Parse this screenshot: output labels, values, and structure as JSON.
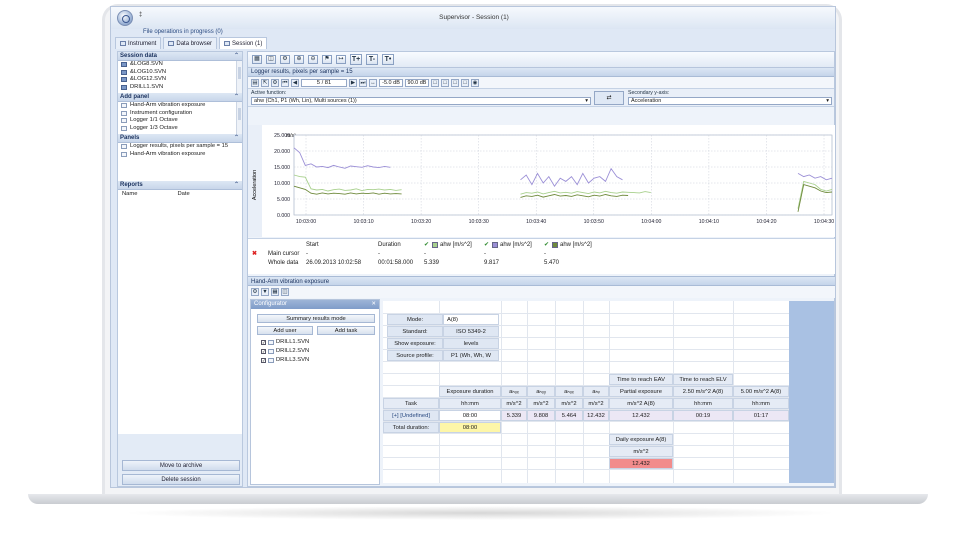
{
  "window": {
    "title": "Supervisor - Session (1)",
    "file_ops": "File operations in progress (0)",
    "qa": "‡"
  },
  "tabs": [
    "Instrument",
    "Data browser",
    "Session (1)"
  ],
  "left": {
    "session_data": {
      "title": "Session data",
      "items": [
        "&LOG8.SVN",
        "&LOG10.SVN",
        "&LOG12.SVN",
        "DRILL1.SVN"
      ]
    },
    "add_panel": {
      "title": "Add panel",
      "items": [
        "Hand-Arm vibration exposure",
        "Instrument configuration",
        "Logger 1/1 Octave",
        "Logger 1/3 Octave"
      ]
    },
    "panels": {
      "title": "Panels",
      "items": [
        "Logger results, pixels per sample = 15",
        "Hand-Arm vibration exposure"
      ]
    },
    "reports": {
      "title": "Reports",
      "col_name": "Name",
      "col_date": "Date"
    },
    "btn_archive": "Move to archive",
    "btn_delete": "Delete session"
  },
  "logger": {
    "title": "Logger results, pixels per sample = 15",
    "nav_value": "5 / 81",
    "db_low": "-5.0 dB",
    "db_high": "90.0 dB",
    "active_function_label": "Active function:",
    "active_function_value": "ahw (Ch1, P1 (Wh, Lin), Multi sources (1))",
    "secondary_label": "Secondary y-axis:",
    "secondary_value": "Acceleration",
    "tb_labels": [
      "T+",
      "T-",
      "T•"
    ]
  },
  "chart_data": {
    "type": "line",
    "ylabel": "Acceleration",
    "yunit": "m/s²",
    "ylim": [
      0,
      25
    ],
    "yticks": [
      "25.000",
      "20.000",
      "15.000",
      "10.000",
      "5.000",
      "0.000"
    ],
    "xticks": [
      "10:03:00",
      "10:03:10",
      "10:03:20",
      "10:03:30",
      "10:03:40",
      "10:03:50",
      "10:04:00",
      "10:04:10",
      "10:04:20",
      "10:04:30"
    ],
    "x": [
      0,
      1,
      2,
      3,
      4,
      5,
      6,
      7,
      8,
      9,
      10,
      11,
      12,
      13,
      14,
      15,
      16,
      17,
      18,
      19,
      20,
      21,
      22,
      23,
      24,
      25,
      26,
      27,
      28,
      29,
      30,
      31,
      32,
      33,
      34,
      35,
      36,
      37,
      38,
      39,
      40,
      41,
      42,
      43,
      44,
      45,
      46,
      47,
      48,
      49,
      50,
      51,
      52,
      53,
      54,
      55,
      56,
      57,
      58,
      59,
      60,
      61,
      62,
      63,
      64,
      65,
      66,
      67,
      68,
      69,
      70,
      71,
      72,
      73,
      74,
      75,
      76,
      77,
      78,
      79,
      80,
      81,
      82,
      83,
      84,
      85,
      86,
      87,
      88,
      89,
      90,
      91,
      92,
      93,
      94,
      95
    ],
    "series": [
      {
        "name": "ahw [m/s^2]",
        "color": "#a8d08d",
        "values": [
          12.5,
          12.0,
          11.8,
          8.2,
          7.8,
          8.0,
          7.5,
          7.9,
          8.1,
          7.7,
          7.8,
          8.2,
          7.6,
          8.0,
          7.9,
          8.1,
          7.8,
          8.0,
          7.7,
          7.9,
          null,
          null,
          null,
          null,
          null,
          null,
          null,
          null,
          null,
          null,
          null,
          null,
          null,
          null,
          null,
          null,
          null,
          null,
          null,
          null,
          6.5,
          7.0,
          6.8,
          7.2,
          6.6,
          7.0,
          7.4,
          6.9,
          7.1,
          6.8,
          7.3,
          7.0,
          6.7,
          7.2,
          6.9,
          7.4,
          7.0,
          6.8,
          7.2,
          7.1,
          7.0,
          6.9,
          7.3,
          7.0,
          null,
          null,
          null,
          null,
          null,
          null,
          null,
          null,
          null,
          null,
          null,
          null,
          null,
          null,
          null,
          null,
          null,
          null,
          null,
          null,
          null,
          null,
          null,
          null,
          null,
          2.0,
          10.5,
          10.0,
          9.5,
          8.0,
          7.5,
          8.0
        ]
      },
      {
        "name": "ahw [m/s^2]",
        "color": "#9b8fd6",
        "values": [
          21.0,
          19.5,
          15.5,
          16.0,
          15.0,
          15.2,
          14.8,
          15.5,
          15.0,
          14.6,
          15.3,
          15.1,
          14.9,
          15.4,
          15.0,
          14.8,
          15.2,
          14.9,
          null,
          null,
          null,
          null,
          null,
          null,
          null,
          null,
          null,
          null,
          null,
          null,
          null,
          null,
          null,
          null,
          null,
          null,
          null,
          null,
          null,
          null,
          11.0,
          12.5,
          9.5,
          13.0,
          10.0,
          12.0,
          9.0,
          11.5,
          10.5,
          12.0,
          9.5,
          13.0,
          10.0,
          11.5,
          12.0,
          10.5,
          14.5,
          12.0,
          11.0,
          null,
          null,
          null,
          null,
          null,
          null,
          null,
          null,
          null,
          null,
          null,
          null,
          null,
          null,
          null,
          null,
          null,
          null,
          null,
          null,
          null,
          null,
          null,
          null,
          null,
          null,
          null,
          null,
          null,
          null,
          13.0,
          12.0,
          12.5,
          11.5,
          12.0,
          11.0,
          11.5
        ]
      },
      {
        "name": "ahw [m/s^2]",
        "color": "#6f8a3c",
        "values": [
          9.0,
          8.5,
          8.0,
          6.8,
          6.5,
          6.9,
          6.6,
          6.8,
          6.7,
          6.5,
          6.9,
          6.6,
          6.8,
          6.7,
          6.9,
          6.5,
          6.8,
          6.6,
          6.7,
          6.6,
          null,
          null,
          null,
          null,
          null,
          null,
          null,
          null,
          null,
          null,
          null,
          null,
          null,
          null,
          null,
          null,
          null,
          null,
          null,
          null,
          5.5,
          6.0,
          5.8,
          6.2,
          5.6,
          6.0,
          6.4,
          5.9,
          6.1,
          5.8,
          6.3,
          6.0,
          5.7,
          6.2,
          5.9,
          6.4,
          6.0,
          5.8,
          6.2,
          6.1,
          null,
          null,
          null,
          null,
          null,
          null,
          null,
          null,
          null,
          null,
          null,
          null,
          null,
          null,
          null,
          null,
          null,
          null,
          null,
          null,
          null,
          null,
          null,
          null,
          null,
          null,
          null,
          null,
          null,
          1.0,
          9.5,
          9.0,
          8.5,
          7.5,
          7.0,
          7.2
        ]
      }
    ]
  },
  "cursors": {
    "header": {
      "start": "Start",
      "duration": "Duration",
      "s1": "ahw [m/s^2]",
      "s2": "ahw [m/s^2]",
      "s3": "ahw [m/s^2]"
    },
    "main": {
      "label": "Main cursor",
      "start": "-",
      "duration": "-",
      "v1": "-",
      "v2": "-",
      "v3": "-"
    },
    "whole": {
      "label": "Whole data",
      "start": "26.09.2013 10:02:58",
      "duration": "00:01:58.000",
      "v1": "5.339",
      "v2": "9.817",
      "v3": "5.470"
    }
  },
  "hav": {
    "title": "Hand-Arm vibration exposure",
    "configurator": "Configurator",
    "btn_summary": "Summary results mode",
    "btn_add_user": "Add user",
    "btn_add_task": "Add task",
    "files": [
      "DRILL1.SVN",
      "DRILL2.SVN",
      "DRILL3.SVN"
    ],
    "mode_label": "Mode:",
    "mode_value": "A(8)",
    "standard_label": "Standard:",
    "standard_value": "ISO 5349-2",
    "show_exposure_label": "Show exposure:",
    "show_exposure_value": "levels",
    "source_label": "Source profile:",
    "source_value": "P1 (Wh, Wh, W",
    "headers": {
      "exposure_duration": "Exposure duration",
      "hhmm": "hh:mm",
      "ahwx": "aₕₒₓ",
      "ahwy": "aₕₒᵧ",
      "ahwz": "aₕₒₓ",
      "ahv": "aₕᵥ",
      "unit": "m/s^2",
      "partial": "Partial exposure",
      "partial_unit": "m/s^2 A(8)",
      "eav": "Time to reach EAV",
      "eav_sub": "2.50 m/s^2 A(8)",
      "eav_unit": "hh:mm",
      "elv": "Time to reach ELV",
      "elv_sub": "5.00 m/s^2 A(8)",
      "elv_unit": "hh:mm",
      "task": "Task"
    },
    "row": {
      "task": "[+] [Undefined]",
      "duration": "08:00",
      "ahwx": "5.339",
      "ahwy": "9.808",
      "ahwz": "5.464",
      "ahv": "12.432",
      "partial": "12.432",
      "eav": "00:19",
      "elv": "01:17"
    },
    "total_label": "Total duration:",
    "total_value": "08:00",
    "daily_label": "Daily exposure A(8)",
    "daily_unit": "m/s^2",
    "daily_value": "12.432"
  },
  "colors": {
    "accent": "#3a5ea8",
    "warn_red": "#f28c8c",
    "total_yellow": "#fdf6a8",
    "tree_bg": "#a9c1e3"
  }
}
